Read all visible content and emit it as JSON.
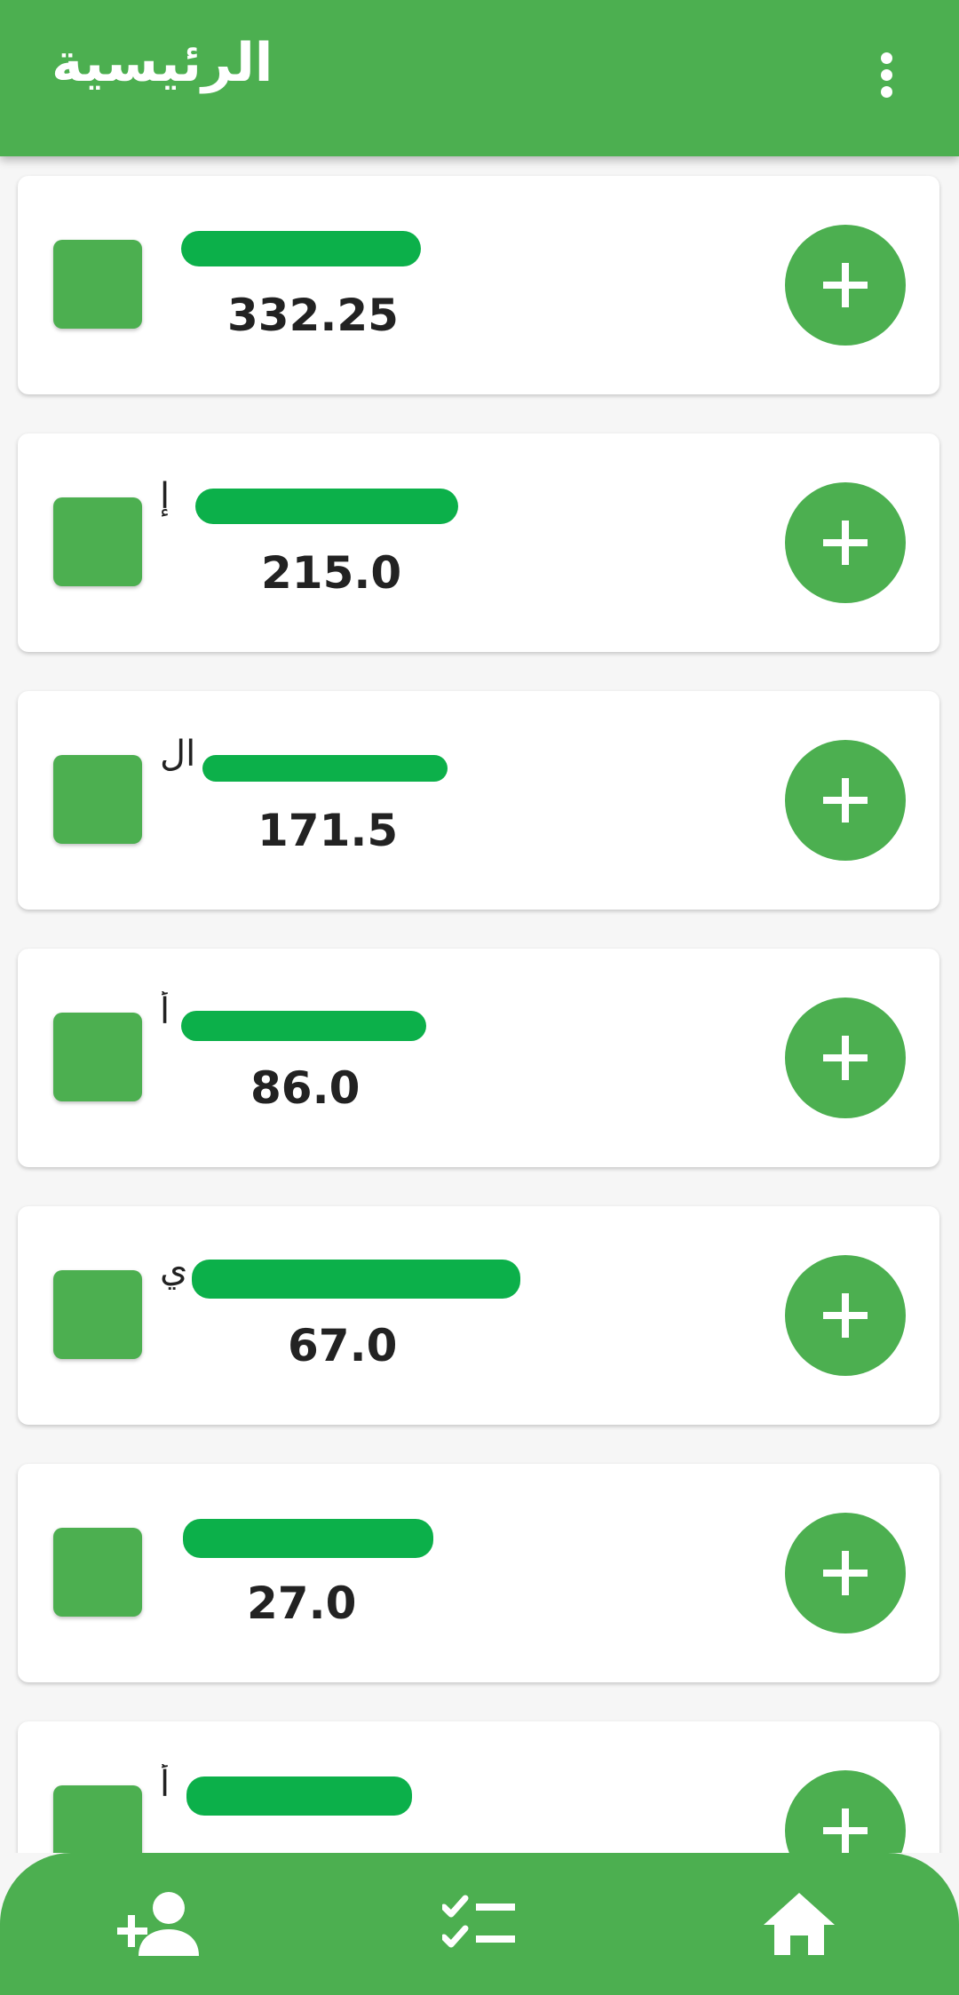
{
  "appbar": {
    "title": "الرئيسية",
    "menu_icon": "more-vert-icon"
  },
  "colors": {
    "primary": "#4caf50",
    "redaction": "#0cb04a",
    "text": "#222222",
    "background": "#f6f6f6"
  },
  "items": [
    {
      "name": "",
      "amount": "332.25"
    },
    {
      "name": "إ",
      "amount": "215.0"
    },
    {
      "name": "ال",
      "amount": "171.5"
    },
    {
      "name": "أ",
      "amount": "86.0"
    },
    {
      "name": "ي",
      "amount": "67.0"
    },
    {
      "name": "",
      "amount": "27.0"
    },
    {
      "name": "أ",
      "amount": ""
    }
  ],
  "item_icons": {
    "add": "plus-icon"
  },
  "bottom_nav": {
    "items": [
      {
        "icon": "person-add-icon"
      },
      {
        "icon": "checklist-icon"
      },
      {
        "icon": "home-icon"
      }
    ]
  }
}
